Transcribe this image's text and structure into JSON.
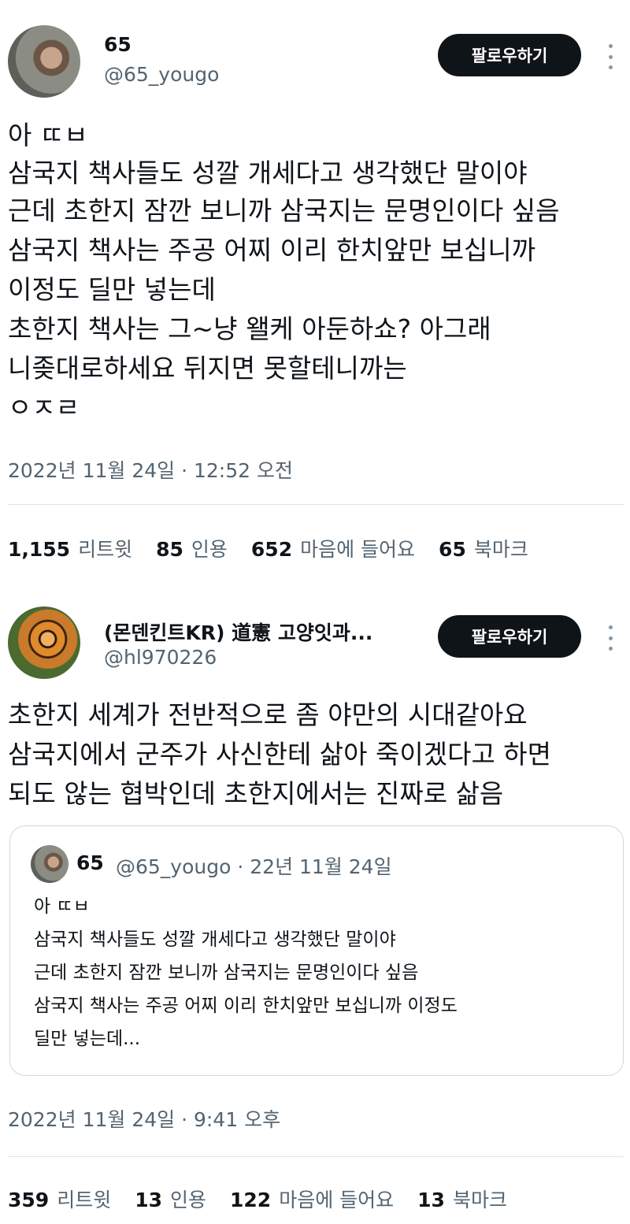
{
  "tweet1": {
    "name": "65",
    "handle": "@65_yougo",
    "follow_label": "팔로우하기",
    "lines": [
      "아 ㄸㅂ",
      "삼국지 책사들도 성깔 개세다고 생각했단 말이야",
      "근데 초한지 잠깐 보니까 삼국지는 문명인이다 싶음",
      "삼국지 책사는 주공 어찌 이리 한치앞만 보십니까",
      "이정도 딜만 넣는데",
      "초한지 책사는 그~냥 왤케 아둔하쇼? 아그래",
      "니좆대로하세요 뒤지면 못할테니까는",
      "ㅇㅈㄹ"
    ],
    "timestamp": "2022년 11월 24일 · 12:52 오전",
    "stats": {
      "retweets": "1,155",
      "retweets_label": "리트윗",
      "quotes": "85",
      "quotes_label": "인용",
      "likes": "652",
      "likes_label": "마음에 들어요",
      "bookmarks": "65",
      "bookmarks_label": "북마크"
    }
  },
  "tweet2": {
    "name": "(몬덴킨트KR) 道憲 고양잇과...",
    "handle": "@hl970226",
    "follow_label": "팔로우하기",
    "lines": [
      "초한지 세계가 전반적으로 좀 야만의 시대같아요",
      "삼국지에서 군주가 사신한테 삶아 죽이겠다고 하면",
      "되도 않는 협박인데 초한지에서는 진짜로 삶음"
    ],
    "quote": {
      "name": "65",
      "handle_date": "@65_yougo · 22년 11월 24일",
      "lines": [
        "아 ㄸㅂ",
        "삼국지 책사들도 성깔 개세다고 생각했단 말이야",
        "근데 초한지 잠깐 보니까 삼국지는 문명인이다 싶음",
        "삼국지 책사는 주공 어찌 이리 한치앞만 보십니까 이정도",
        "딜만 넣는데..."
      ]
    },
    "timestamp": "2022년 11월 24일 · 9:41 오후",
    "stats": {
      "retweets": "359",
      "retweets_label": "리트윗",
      "quotes": "13",
      "quotes_label": "인용",
      "likes": "122",
      "likes_label": "마음에 들어요",
      "bookmarks": "13",
      "bookmarks_label": "북마크"
    }
  }
}
